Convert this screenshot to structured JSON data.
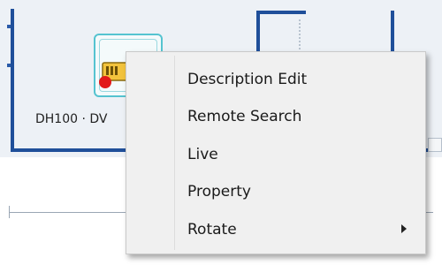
{
  "device": {
    "label": "DH100 · DV",
    "status_color": "#e21a1a",
    "icon": "camera-device-icon"
  },
  "context_menu": {
    "items": [
      {
        "label": "Description Edit",
        "has_submenu": false
      },
      {
        "label": "Remote Search",
        "has_submenu": false
      },
      {
        "label": "Live",
        "has_submenu": false
      },
      {
        "label": "Property",
        "has_submenu": false
      },
      {
        "label": "Rotate",
        "has_submenu": true,
        "submenu_icon": "chevron-right-icon"
      }
    ]
  },
  "colors": {
    "wall": "#1f4f9a",
    "tile_border": "#55c3d0",
    "menu_background": "#f0f0f0"
  }
}
